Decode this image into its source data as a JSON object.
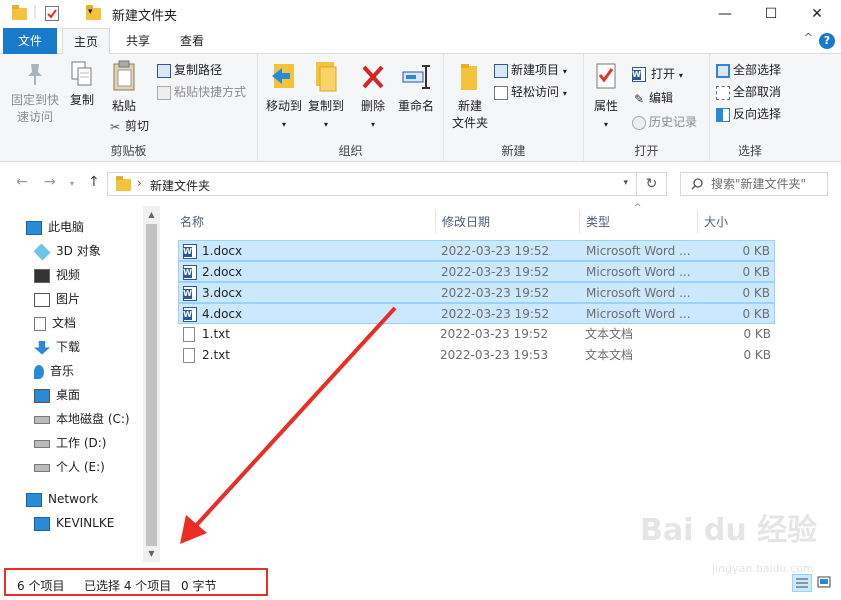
{
  "window": {
    "title": "新建文件夹",
    "minimize": "—",
    "maximize": "☐",
    "close": "✕"
  },
  "tabs": {
    "file": "文件",
    "home": "主页",
    "share": "共享",
    "view": "查看",
    "help": "?",
    "collapse": "^"
  },
  "ribbon": {
    "clipboard": {
      "label": "剪贴板",
      "pin": "固定到快\n速访问",
      "pin_l1": "固定到快",
      "pin_l2": "速访问",
      "copy": "复制",
      "paste": "粘贴",
      "copy_path": "复制路径",
      "paste_shortcut": "粘贴快捷方式",
      "cut": "剪切"
    },
    "organize": {
      "label": "组织",
      "move_to": "移动到",
      "copy_to": "复制到",
      "delete": "删除",
      "rename": "重命名"
    },
    "new": {
      "label": "新建",
      "new_folder_l1": "新建",
      "new_folder_l2": "文件夹",
      "new_item": "新建项目",
      "easy_access": "轻松访问"
    },
    "open": {
      "label": "打开",
      "properties": "属性",
      "open": "打开",
      "edit": "编辑",
      "history": "历史记录"
    },
    "select": {
      "label": "选择",
      "select_all": "全部选择",
      "select_none": "全部取消",
      "invert": "反向选择"
    }
  },
  "address": {
    "path": "新建文件夹",
    "search_placeholder": "搜索\"新建文件夹\""
  },
  "nav": {
    "items": [
      {
        "label": "此电脑",
        "icon": "pc-icon"
      },
      {
        "label": "3D 对象",
        "icon": "3d-objects-icon"
      },
      {
        "label": "视频",
        "icon": "video-icon"
      },
      {
        "label": "图片",
        "icon": "pictures-icon"
      },
      {
        "label": "文档",
        "icon": "documents-icon"
      },
      {
        "label": "下载",
        "icon": "downloads-icon"
      },
      {
        "label": "音乐",
        "icon": "music-icon"
      },
      {
        "label": "桌面",
        "icon": "desktop-icon"
      },
      {
        "label": "本地磁盘 (C:)",
        "icon": "drive-c-icon"
      },
      {
        "label": "工作 (D:)",
        "icon": "drive-d-icon"
      },
      {
        "label": "个人 (E:)",
        "icon": "drive-e-icon"
      },
      {
        "label": "Network",
        "icon": "network-icon"
      },
      {
        "label": "KEVINLKE",
        "icon": "computer-icon"
      }
    ]
  },
  "columns": {
    "name": "名称",
    "date": "修改日期",
    "type": "类型",
    "size": "大小"
  },
  "files": [
    {
      "name": "1.docx",
      "date": "2022-03-23 19:52",
      "type": "Microsoft Word ...",
      "size": "0 KB",
      "selected": true,
      "kind": "word"
    },
    {
      "name": "2.docx",
      "date": "2022-03-23 19:52",
      "type": "Microsoft Word ...",
      "size": "0 KB",
      "selected": true,
      "kind": "word"
    },
    {
      "name": "3.docx",
      "date": "2022-03-23 19:52",
      "type": "Microsoft Word ...",
      "size": "0 KB",
      "selected": true,
      "kind": "word"
    },
    {
      "name": "4.docx",
      "date": "2022-03-23 19:52",
      "type": "Microsoft Word ...",
      "size": "0 KB",
      "selected": true,
      "kind": "word"
    },
    {
      "name": "1.txt",
      "date": "2022-03-23 19:52",
      "type": "文本文档",
      "size": "0 KB",
      "selected": false,
      "kind": "text"
    },
    {
      "name": "2.txt",
      "date": "2022-03-23 19:53",
      "type": "文本文档",
      "size": "0 KB",
      "selected": false,
      "kind": "text"
    }
  ],
  "status": {
    "item_count": "6 个项目",
    "selected": "已选择 4 个项目",
    "size": "0 字节"
  },
  "watermark": {
    "main": "Bai du 经验",
    "sub": "jingyan.baidu.com"
  },
  "colors": {
    "accent": "#1979ca",
    "selection": "#cce8ff",
    "annotation": "#e8302b"
  }
}
